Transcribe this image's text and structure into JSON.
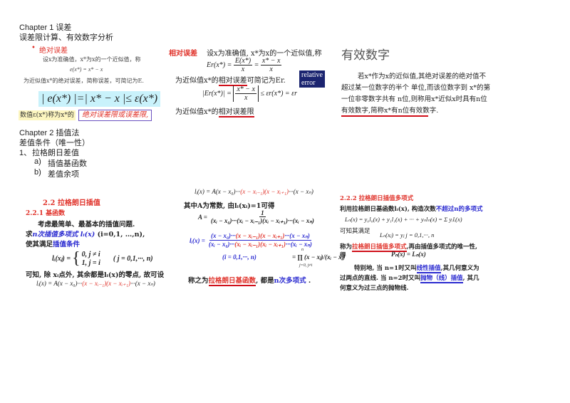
{
  "left_column": {
    "chapter1_title": "Chapter 1  误差",
    "chapter1_subtitle": "误差限计算、有效数字分析",
    "abs_error": {
      "bullet": "•",
      "heading": "绝对误差",
      "line1": "设x为准确值，x*为x的一个近似值，称",
      "formula": "e(x*) = x* − x",
      "line2": "为近似值x*的绝对误差，简称误差，可简记为E.",
      "bound_formula": "| e(x*) |=| x* − x |≤ ε(x*)",
      "note_prefix": "数值ε(x*)称为x*的",
      "note_boxed": "绝对误差限或误差限,"
    },
    "chapter2_title": "Chapter 2  插值法",
    "chapter2_line1": "差值条件（唯一性）",
    "list_item1_num": "1、",
    "list_item1": "拉格朗日差值",
    "sub_a_label": "a)",
    "sub_a": "插值基函数",
    "sub_b_label": "b)",
    "sub_b": "差值余项"
  },
  "middle_column": {
    "heading": "相对误差",
    "line1": "设x为准确值, x*为x的一个近似值,称",
    "formula_lhs": "Er(x*) =",
    "formula_frac1_num": "E(x*)",
    "formula_frac1_den": "x",
    "formula_eq": "=",
    "formula_frac2_num": "x* − x",
    "formula_frac2_den": "x",
    "line2_prefix": "为近似值x*的",
    "line2_ul": "相对误差",
    "line2_suffix": "可简记为Er.",
    "rel_box_line1": "relative",
    "rel_box_line2": "error",
    "bound_lhs": "|Er(x*)| =",
    "bound_num": "x* − x",
    "bound_den": "x",
    "bound_rhs": "≤ εr(x*) = εr",
    "line3_prefix": "为近似值x*的",
    "line3_ul": "相对误差限"
  },
  "right_column": {
    "heading": "有效数字",
    "para_line1": "若x*作为x的近似值,其绝对误差的绝对值不",
    "para_line2": "超过某一位数字的半个 单位,而该位数字到 x*的第",
    "para_line3": "一位非零数字共有 n位,则称用x*近似x时具有n位",
    "para_line4": "有效数字,简称x*有n位有效数字."
  },
  "lagrange_left": {
    "section_title": "2.2  拉格朗日插值",
    "subsection_title": "2.2.1  基函数",
    "line1": "考虑最简单、最基本的插值问题.",
    "line2_prefix": "求",
    "line2_blue": "n次插值多项式 lᵢ(x)",
    "line2_suffix": "(i=0,1, …,n),",
    "line3_prefix": "使其满足",
    "line3_blue": "插值条件",
    "cond_lhs": "lᵢ(xⱼ) =",
    "cond_case1": "0,    j ≠ i",
    "cond_case2": "1,    j = i",
    "cond_range": "( j = 0,1,···, n)",
    "line4": "可知, 除 xᵢ点外, 其余都是lᵢ(x)的零点, 故可设",
    "formula_black1": "lᵢ(x) = A(x − x₀)···",
    "formula_red": "(x − xᵢ₋₁)(x − xᵢ₊₁)",
    "formula_black2": "···(x − xₙ)"
  },
  "lagrange_middle": {
    "formula_black1": "lᵢ(x) = A(x − x₀)···",
    "formula_red": "(x − xᵢ₋₁)(x − xᵢ₊₁)",
    "formula_black2": "···(x − xₙ)",
    "line1": "其中A为常数, 由lᵢ(xᵢ)=1可得",
    "a_lhs": "A =",
    "a_num": "1",
    "a_den": "(xᵢ − x₀)···(xᵢ − xᵢ₋₁)(xᵢ − xᵢ₊₁)···(xᵢ − xₙ)",
    "l_lhs": "lᵢ(x) =",
    "l_num_blue1": "(x − x₀)···",
    "l_num_red": "(x − xᵢ₋₁)(x − xᵢ₊₁)",
    "l_num_blue2": "···(x − xₙ)",
    "l_den_blue1": "(xᵢ − x₀)···",
    "l_den_red": "(xᵢ − xᵢ₋₁)(xᵢ − xᵢ₊₁)",
    "l_den_blue2": "···(xᵢ − xₙ)",
    "range": "(i = 0,1,···, n)",
    "product": "= ∏ (x − xⱼ)/(xᵢ − xⱼ)",
    "product_sub": "j=0, j≠i",
    "product_sup": "n",
    "line2_prefix": "称之为",
    "line2_red": "拉格朗日基函数",
    "line2_mid": ", 都是",
    "line2_blue": "n次多项式",
    "line2_suffix": " ."
  },
  "lagrange_right": {
    "subsection_title": "2.2.2  拉格朗日插值多项式",
    "line1_prefix": "利用拉格朗日基函数lᵢ(x), 构造次数",
    "line1_blue": "不超过n的多项式",
    "formula1": "Lₙ(x) = y₀l₀(x) + y₁l₁(x) + ··· + yₙlₙ(x) = Σ yᵢlᵢ(x)",
    "line2": "可知其满足",
    "formula2": "Lₙ(xⱼ) = yⱼ   j = 0,1,···, n",
    "line3_prefix": "称为",
    "line3_red": "拉格朗日插值多项式",
    "line3_suffix": ",再由插值多项式的唯一性,",
    "line4": "得",
    "formula3": "Pₙ(x) = Lₙ(x)",
    "line5_prefix": "特别地, 当 n=1时又叫",
    "line5_blue": "线性插值",
    "line5_suffix": ",其几何意义为",
    "line6_prefix": "过两点的直线. 当 n=2时又叫",
    "line6_blue": "抛物（线）插值",
    "line6_suffix": ", 其几",
    "line7": "何意义为过三点的抛物线."
  }
}
